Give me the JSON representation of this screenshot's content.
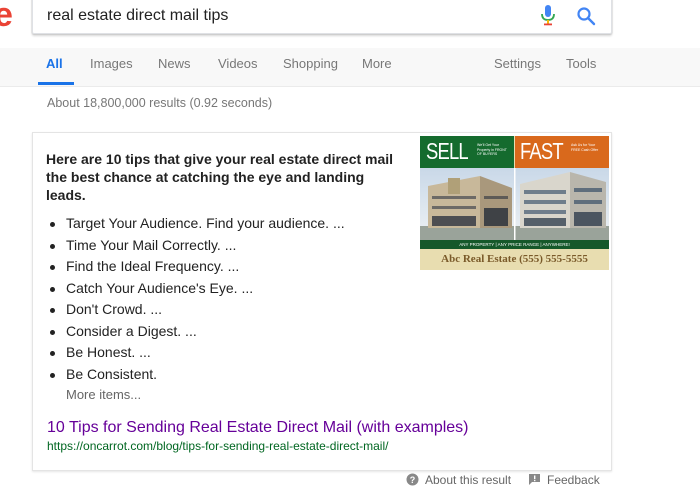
{
  "logo": {
    "letter": "e"
  },
  "search": {
    "query": "real estate direct mail tips"
  },
  "tabs": [
    {
      "label": "All"
    },
    {
      "label": "Images"
    },
    {
      "label": "News"
    },
    {
      "label": "Videos"
    },
    {
      "label": "Shopping"
    },
    {
      "label": "More"
    },
    {
      "label": "Settings"
    },
    {
      "label": "Tools"
    }
  ],
  "result_stats": "About 18,800,000 results (0.92 seconds)",
  "snippet": {
    "heading": "Here are 10 tips that give your real estate direct mail the best chance at catching the eye and landing leads.",
    "tips": [
      "Target Your Audience. Find your audience. ...",
      "Time Your Mail Correctly. ...",
      "Find the Ideal Frequency. ...",
      "Catch Your Audience's Eye. ...",
      "Don't Crowd. ...",
      "Consider a Digest. ...",
      "Be Honest. ...",
      "Be Consistent."
    ],
    "more_items": "More items...",
    "title": "10 Tips for Sending Real Estate Direct Mail (with examples)",
    "url": "https://oncarrot.com/blog/tips-for-sending-real-estate-direct-mail/",
    "image": {
      "word_left": "SELL",
      "word_right": "FAST",
      "small_left": "We'll Get Your Property in FRONT OF BUYERS",
      "small_right": "Ask Us for Your FREE Cash Offer",
      "strip": "ANY PROPERTY | ANY PRICE RANGE | ANYWHERE!",
      "footer": "Abc Real Estate (555) 555-5555"
    }
  },
  "footer": {
    "about": "About this result",
    "feedback": "Feedback"
  },
  "colors": {
    "accent": "#1a73e8",
    "visited_link": "#660099",
    "url_green": "#006621",
    "logo_red": "#ea4335"
  }
}
